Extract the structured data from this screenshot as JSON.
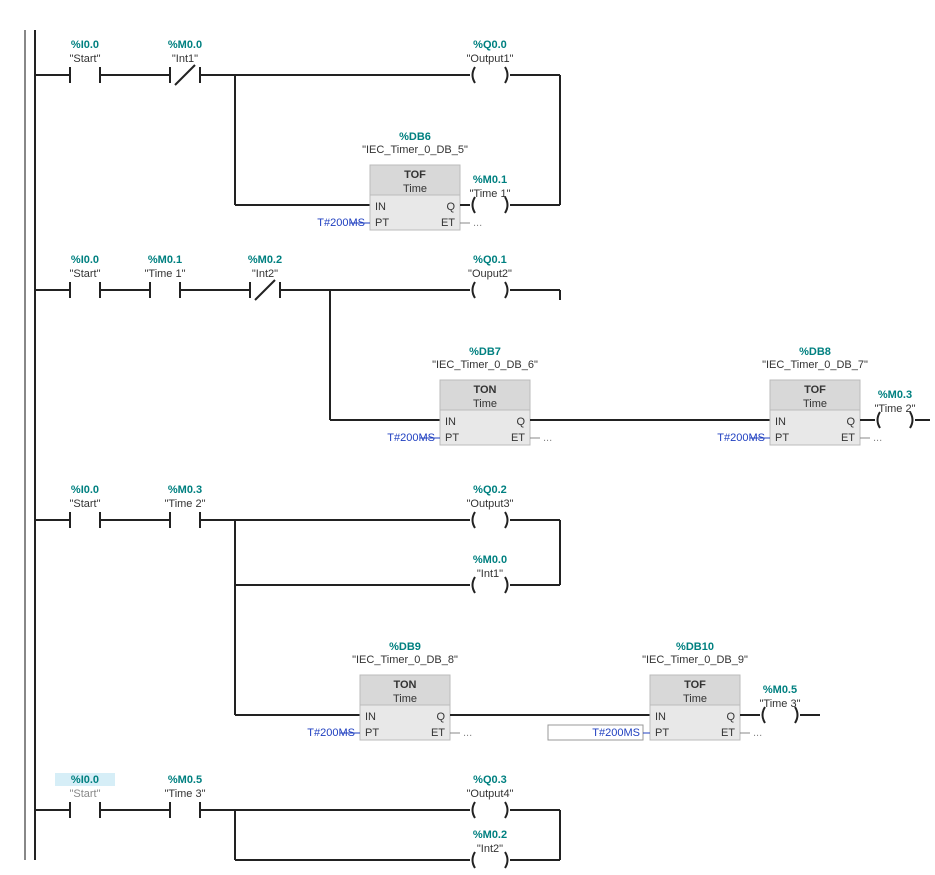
{
  "rung1": {
    "c1": {
      "addr": "%I0.0",
      "name": "\"Start\""
    },
    "c2": {
      "addr": "%M0.0",
      "name": "\"Int1\""
    },
    "coil1": {
      "addr": "%Q0.0",
      "name": "\"Output1\""
    },
    "fb1": {
      "db": "%DB6",
      "dbname": "\"IEC_Timer_0_DB_5\"",
      "type": "TOF",
      "dtype": "Time",
      "pt": "T#200MS",
      "et": "..."
    },
    "coil2": {
      "addr": "%M0.1",
      "name": "\"Time 1\""
    }
  },
  "rung2": {
    "c1": {
      "addr": "%I0.0",
      "name": "\"Start\""
    },
    "c2": {
      "addr": "%M0.1",
      "name": "\"Time 1\""
    },
    "c3": {
      "addr": "%M0.2",
      "name": "\"Int2\""
    },
    "coil1": {
      "addr": "%Q0.1",
      "name": "\"Ouput2\""
    },
    "fb1": {
      "db": "%DB7",
      "dbname": "\"IEC_Timer_0_DB_6\"",
      "type": "TON",
      "dtype": "Time",
      "pt": "T#200MS",
      "et": "..."
    },
    "fb2": {
      "db": "%DB8",
      "dbname": "\"IEC_Timer_0_DB_7\"",
      "type": "TOF",
      "dtype": "Time",
      "pt": "T#200MS",
      "et": "..."
    },
    "coil2": {
      "addr": "%M0.3",
      "name": "\"Time 2\""
    }
  },
  "rung3": {
    "c1": {
      "addr": "%I0.0",
      "name": "\"Start\""
    },
    "c2": {
      "addr": "%M0.3",
      "name": "\"Time 2\""
    },
    "coil1": {
      "addr": "%Q0.2",
      "name": "\"Output3\""
    },
    "coil2": {
      "addr": "%M0.0",
      "name": "\"Int1\""
    },
    "fb1": {
      "db": "%DB9",
      "dbname": "\"IEC_Timer_0_DB_8\"",
      "type": "TON",
      "dtype": "Time",
      "pt": "T#200MS",
      "et": "..."
    },
    "fb2": {
      "db": "%DB10",
      "dbname": "\"IEC_Timer_0_DB_9\"",
      "type": "TOF",
      "dtype": "Time",
      "pt": "T#200MS",
      "et": "..."
    },
    "coil3": {
      "addr": "%M0.5",
      "name": "\"Time 3\""
    }
  },
  "rung4": {
    "c1": {
      "addr": "%I0.0",
      "name": "\"Start\""
    },
    "c2": {
      "addr": "%M0.5",
      "name": "\"Time 3\""
    },
    "coil1": {
      "addr": "%Q0.3",
      "name": "\"Output4\""
    },
    "coil2": {
      "addr": "%M0.2",
      "name": "\"Int2\""
    }
  },
  "labels": {
    "in": "IN",
    "q": "Q",
    "pt": "PT",
    "et": "ET"
  }
}
